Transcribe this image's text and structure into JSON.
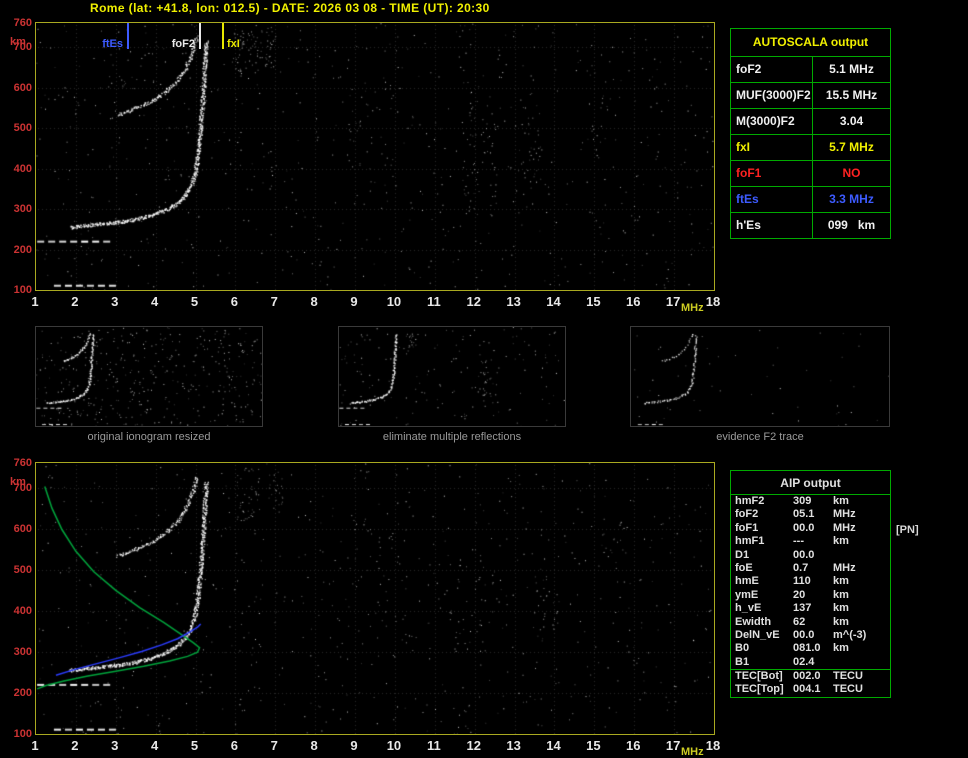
{
  "header": {
    "title": "Rome (lat: +41.8, lon: 012.5) - DATE: 2026 03 08 - TIME (UT): 20:30"
  },
  "colors": {
    "title": "#f0f000",
    "plot_border": "#a9a920",
    "axis_km": "#cc3333",
    "axis_mhz": "#e8e8e8",
    "unit_mhz": "#cccc22",
    "table_border": "#00aa00",
    "caption": "#9a9a9a"
  },
  "autoscala_table": {
    "title": "AUTOSCALA output",
    "rows": [
      {
        "label": "foF2",
        "value": "5.1 MHz",
        "color": "#f0f0f0"
      },
      {
        "label": "MUF(3000)F2",
        "value": "15.5 MHz",
        "color": "#f0f0f0"
      },
      {
        "label": "M(3000)F2",
        "value": "3.04",
        "color": "#f0f0f0"
      },
      {
        "label": "fxI",
        "value": "5.7 MHz",
        "color": "#f0f000"
      },
      {
        "label": "foF1",
        "value": "NO",
        "color": "#ff2222"
      },
      {
        "label": "ftEs",
        "value": "3.3 MHz",
        "color": "#3d5bff"
      },
      {
        "label": "h'Es",
        "value": "099   km",
        "color": "#f0f0f0"
      }
    ]
  },
  "thumbnails": [
    {
      "caption": "original ionogram resized"
    },
    {
      "caption": "eliminate multiple reflections"
    },
    {
      "caption": "evidence F2 trace"
    }
  ],
  "aip_table": {
    "title": "AIP output",
    "foF1_note": "[PN]",
    "rows": [
      {
        "label": "hmF2",
        "value": "309",
        "unit": "km"
      },
      {
        "label": "foF2",
        "value": "05.1",
        "unit": "MHz"
      },
      {
        "label": "foF1",
        "value": "00.0",
        "unit": "MHz"
      },
      {
        "label": "hmF1",
        "value": "---",
        "unit": "km"
      },
      {
        "label": "D1",
        "value": "00.0",
        "unit": ""
      },
      {
        "label": "foE",
        "value": "0.7",
        "unit": "MHz"
      },
      {
        "label": "hmE",
        "value": "110",
        "unit": "km"
      },
      {
        "label": "ymE",
        "value": "20",
        "unit": "km"
      },
      {
        "label": "h_vE",
        "value": "137",
        "unit": "km"
      },
      {
        "label": "Ewidth",
        "value": "62",
        "unit": "km"
      },
      {
        "label": "DelN_vE",
        "value": "00.0",
        "unit": "m^(-3)"
      },
      {
        "label": "B0",
        "value": "081.0",
        "unit": "km"
      },
      {
        "label": "B1",
        "value": "02.4",
        "unit": ""
      }
    ],
    "tec_rows": [
      {
        "label": "TEC[Bot]",
        "value": "002.0",
        "unit": "TECU"
      },
      {
        "label": "TEC[Top]",
        "value": "004.1",
        "unit": "TECU"
      }
    ]
  },
  "plots": {
    "x_ticks": [
      "1",
      "2",
      "3",
      "4",
      "5",
      "6",
      "7",
      "8",
      "9",
      "10",
      "11",
      "12",
      "13",
      "14",
      "15",
      "16",
      "17",
      "18"
    ],
    "x_unit": "MHz",
    "y_ticks": [
      "760",
      "700",
      "600",
      "500",
      "400",
      "300",
      "200",
      "100"
    ],
    "y_unit": "km",
    "markers": [
      {
        "name": "ftEs",
        "f": 3.3,
        "color": "#3d5bff",
        "side": "left"
      },
      {
        "name": "foF2",
        "f": 5.1,
        "color": "#e8e8e8",
        "side": "left"
      },
      {
        "name": "fxI",
        "f": 5.7,
        "color": "#e8e800",
        "side": "right"
      }
    ],
    "traces": {
      "f2_first": [
        [
          1.85,
          256
        ],
        [
          2.2,
          260
        ],
        [
          2.6,
          264
        ],
        [
          3.0,
          268
        ],
        [
          3.4,
          274
        ],
        [
          3.8,
          283
        ],
        [
          4.15,
          295
        ],
        [
          4.45,
          310
        ],
        [
          4.7,
          330
        ],
        [
          4.87,
          355
        ],
        [
          4.97,
          385
        ],
        [
          5.03,
          420
        ],
        [
          5.08,
          460
        ],
        [
          5.12,
          505
        ],
        [
          5.16,
          555
        ],
        [
          5.2,
          610
        ],
        [
          5.23,
          665
        ],
        [
          5.26,
          715
        ]
      ],
      "f2_second": [
        [
          3.05,
          535
        ],
        [
          3.35,
          545
        ],
        [
          3.65,
          557
        ],
        [
          3.95,
          572
        ],
        [
          4.25,
          592
        ],
        [
          4.5,
          615
        ],
        [
          4.7,
          642
        ],
        [
          4.85,
          672
        ],
        [
          4.95,
          700
        ],
        [
          5.02,
          728
        ]
      ]
    },
    "es_dashes": [
      {
        "km": 222,
        "f1": 1.03,
        "f2": 2.85
      },
      {
        "km": 113,
        "f1": 1.45,
        "f2": 3.08
      }
    ],
    "profile_curves": [
      {
        "name": "electron-density-profile",
        "color": "#00a43c",
        "points": [
          [
            1.22,
            703
          ],
          [
            1.4,
            650
          ],
          [
            1.65,
            598
          ],
          [
            2.0,
            545
          ],
          [
            2.45,
            495
          ],
          [
            3.0,
            450
          ],
          [
            3.6,
            408
          ],
          [
            4.2,
            372
          ],
          [
            4.65,
            342
          ],
          [
            4.95,
            322
          ],
          [
            5.1,
            310
          ],
          [
            5.05,
            299
          ],
          [
            4.8,
            289
          ],
          [
            4.35,
            278
          ],
          [
            3.7,
            265
          ],
          [
            3.0,
            253
          ],
          [
            2.3,
            241
          ],
          [
            1.7,
            229
          ],
          [
            1.25,
            218
          ],
          [
            1.03,
            210
          ]
        ]
      },
      {
        "name": "fitted-trace",
        "color": "#2b3cff",
        "points": [
          [
            1.5,
            243
          ],
          [
            2.0,
            258
          ],
          [
            2.55,
            272
          ],
          [
            3.1,
            286
          ],
          [
            3.65,
            301
          ],
          [
            4.15,
            317
          ],
          [
            4.55,
            332
          ],
          [
            4.85,
            348
          ],
          [
            5.05,
            360
          ],
          [
            5.13,
            368
          ]
        ]
      }
    ]
  }
}
